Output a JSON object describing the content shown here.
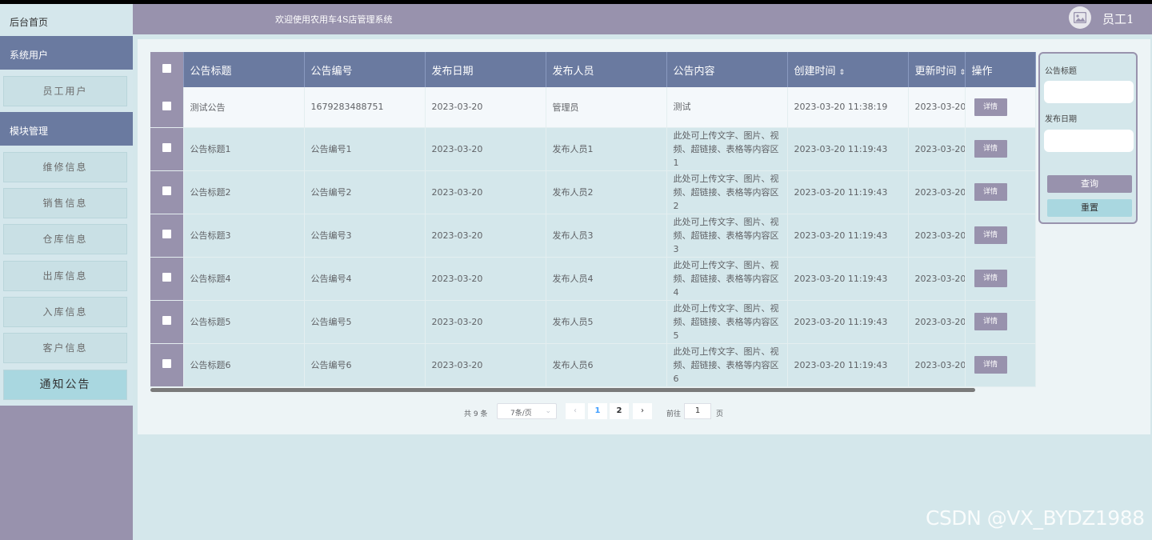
{
  "header": {
    "welcome": "欢迎使用农用车4S店管理系统",
    "username": "员工1"
  },
  "sidebar": {
    "home": "后台首页",
    "sections": [
      {
        "title": "系统用户",
        "items": [
          {
            "label": "员工用户"
          }
        ]
      },
      {
        "title": "模块管理",
        "items": [
          {
            "label": "维修信息"
          },
          {
            "label": "销售信息"
          },
          {
            "label": "仓库信息"
          },
          {
            "label": "出库信息"
          },
          {
            "label": "入库信息"
          },
          {
            "label": "客户信息"
          },
          {
            "label": "通知公告",
            "active": true
          }
        ]
      }
    ]
  },
  "table": {
    "columns": [
      "公告标题",
      "公告编号",
      "发布日期",
      "发布人员",
      "公告内容",
      "创建时间",
      "更新时间",
      "操作"
    ],
    "detail_label": "详情",
    "rows": [
      {
        "title": "测试公告",
        "code": "1679283488751",
        "date": "2023-03-20",
        "publisher": "管理员",
        "content": "测试",
        "created": "2023-03-20 11:38:19",
        "updated": "2023-03-20"
      },
      {
        "title": "公告标题1",
        "code": "公告编号1",
        "date": "2023-03-20",
        "publisher": "发布人员1",
        "content": "此处可上传文字、图片、视频、超链接、表格等内容区1",
        "created": "2023-03-20 11:19:43",
        "updated": "2023-03-20"
      },
      {
        "title": "公告标题2",
        "code": "公告编号2",
        "date": "2023-03-20",
        "publisher": "发布人员2",
        "content": "此处可上传文字、图片、视频、超链接、表格等内容区2",
        "created": "2023-03-20 11:19:43",
        "updated": "2023-03-20"
      },
      {
        "title": "公告标题3",
        "code": "公告编号3",
        "date": "2023-03-20",
        "publisher": "发布人员3",
        "content": "此处可上传文字、图片、视频、超链接、表格等内容区3",
        "created": "2023-03-20 11:19:43",
        "updated": "2023-03-20"
      },
      {
        "title": "公告标题4",
        "code": "公告编号4",
        "date": "2023-03-20",
        "publisher": "发布人员4",
        "content": "此处可上传文字、图片、视频、超链接、表格等内容区4",
        "created": "2023-03-20 11:19:43",
        "updated": "2023-03-20"
      },
      {
        "title": "公告标题5",
        "code": "公告编号5",
        "date": "2023-03-20",
        "publisher": "发布人员5",
        "content": "此处可上传文字、图片、视频、超链接、表格等内容区5",
        "created": "2023-03-20 11:19:43",
        "updated": "2023-03-20"
      },
      {
        "title": "公告标题6",
        "code": "公告编号6",
        "date": "2023-03-20",
        "publisher": "发布人员6",
        "content": "此处可上传文字、图片、视频、超链接、表格等内容区6",
        "created": "2023-03-20 11:19:43",
        "updated": "2023-03-20"
      }
    ]
  },
  "pagination": {
    "total": "共 9 条",
    "page_size": "7条/页",
    "pages": [
      "1",
      "2"
    ],
    "current": "1",
    "goto_label": "前往",
    "goto_value": "1",
    "page_suffix": "页"
  },
  "search": {
    "title_label": "公告标题",
    "date_label": "发布日期",
    "query_button": "查询",
    "reset_button": "重置"
  },
  "watermark": "CSDN @VX_BYDZ1988",
  "colors": {
    "accent": "#9892ad",
    "header_blue": "#6a7aa0",
    "background": "#d4e7eb"
  }
}
